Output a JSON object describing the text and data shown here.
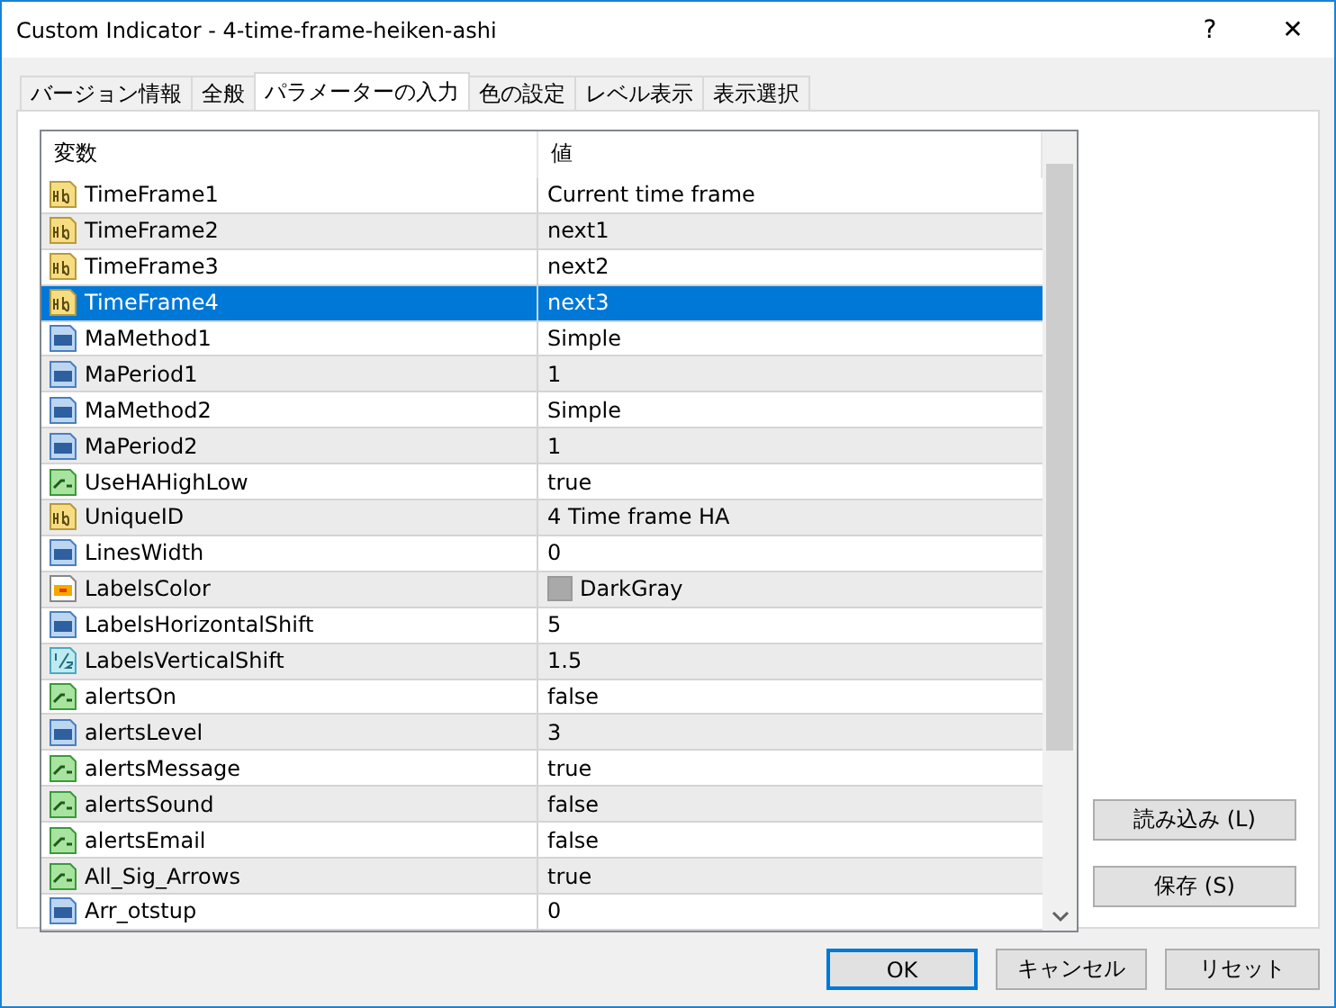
{
  "window": {
    "title": "Custom Indicator - 4-time-frame-heiken-ashi",
    "help": "?",
    "close": "✕"
  },
  "tabs": [
    {
      "label": "バージョン情報",
      "selected": false
    },
    {
      "label": "全般",
      "selected": false
    },
    {
      "label": "パラメーターの入力",
      "selected": true
    },
    {
      "label": "色の設定",
      "selected": false
    },
    {
      "label": "レベル表示",
      "selected": false
    },
    {
      "label": "表示選択",
      "selected": false
    }
  ],
  "table": {
    "columns": [
      "変数",
      "値"
    ],
    "rows": [
      {
        "kind": "text",
        "name": "TimeFrame1",
        "value": "Current time frame",
        "selected": false
      },
      {
        "kind": "text",
        "name": "TimeFrame2",
        "value": "next1",
        "selected": false
      },
      {
        "kind": "text",
        "name": "TimeFrame3",
        "value": "next2",
        "selected": false
      },
      {
        "kind": "text",
        "name": "TimeFrame4",
        "value": "next3",
        "selected": true
      },
      {
        "kind": "int",
        "name": "MaMethod1",
        "value": "Simple",
        "selected": false
      },
      {
        "kind": "int",
        "name": "MaPeriod1",
        "value": "1",
        "selected": false
      },
      {
        "kind": "int",
        "name": "MaMethod2",
        "value": "Simple",
        "selected": false
      },
      {
        "kind": "int",
        "name": "MaPeriod2",
        "value": "1",
        "selected": false
      },
      {
        "kind": "bool",
        "name": "UseHAHighLow",
        "value": "true",
        "selected": false
      },
      {
        "kind": "text",
        "name": "UniqueID",
        "value": "4 Time frame HA",
        "selected": false
      },
      {
        "kind": "int",
        "name": "LinesWidth",
        "value": "0",
        "selected": false
      },
      {
        "kind": "color",
        "name": "LabelsColor",
        "value": "DarkGray",
        "color": "#a9a9a9",
        "selected": false
      },
      {
        "kind": "int",
        "name": "LabelsHorizontalShift",
        "value": "5",
        "selected": false
      },
      {
        "kind": "double",
        "name": "LabelsVerticalShift",
        "value": "1.5",
        "selected": false
      },
      {
        "kind": "bool",
        "name": "alertsOn",
        "value": "false",
        "selected": false
      },
      {
        "kind": "int",
        "name": "alertsLevel",
        "value": "3",
        "selected": false
      },
      {
        "kind": "bool",
        "name": "alertsMessage",
        "value": "true",
        "selected": false
      },
      {
        "kind": "bool",
        "name": "alertsSound",
        "value": "false",
        "selected": false
      },
      {
        "kind": "bool",
        "name": "alertsEmail",
        "value": "false",
        "selected": false
      },
      {
        "kind": "bool",
        "name": "All_Sig_Arrows",
        "value": "true",
        "selected": false
      },
      {
        "kind": "int",
        "name": "Arr_otstup",
        "value": "0",
        "selected": false
      }
    ]
  },
  "side_buttons": [
    "読み込み (L)",
    "保存 (S)"
  ],
  "buttons": [
    {
      "label": "OK",
      "default": true
    },
    {
      "label": "キャンセル",
      "default": false
    },
    {
      "label": "リセット",
      "default": false
    }
  ]
}
